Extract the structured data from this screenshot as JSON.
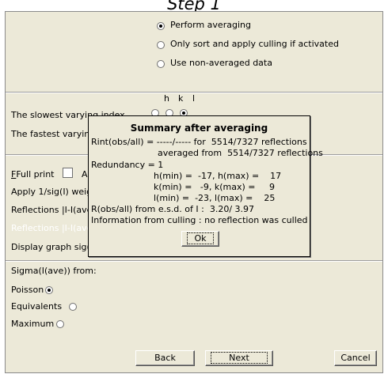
{
  "window": {
    "title": "Step 1"
  },
  "averaging": {
    "options": [
      {
        "label": "Perform averaging",
        "checked": true
      },
      {
        "label": "Only sort and apply culling if activated",
        "checked": false
      },
      {
        "label": "Use non-averaged data",
        "checked": false
      }
    ]
  },
  "index": {
    "headers": [
      "h",
      "k",
      "l"
    ],
    "slowest_label": "The slowest varying index",
    "fastest_label": "The fastest varying index"
  },
  "options": {
    "full_print_label": "Full print",
    "full_print_suffix": "A",
    "apply_label": "Apply 1/sig(I) weig",
    "reflections1_label": "Reflections |I-I(ave",
    "reflections2_label": "Reflections |I-I(ave",
    "display_label": "Display graph sig(I"
  },
  "sigma": {
    "label": "Sigma(I(ave)) from:",
    "options": [
      {
        "label": "Poisson",
        "checked": true
      },
      {
        "label": "Equivalents",
        "checked": false
      },
      {
        "label": "Maximum",
        "checked": false
      }
    ]
  },
  "buttons": {
    "back": "Back",
    "next": "Next",
    "cancel": "Cancel"
  },
  "summary": {
    "title": "Summary after averaging",
    "rint_line": "Rint(obs/all) = -----/----- for  5514/7327 reflections",
    "averaged_line": "averaged from  5514/7327 reflections",
    "redundancy_line": "Redundancy = 1",
    "h_line": "h(min) =  -17, h(max) =    17",
    "k_line": "k(min) =   -9, k(max) =     9",
    "l_line": "l(min) =  -23, l(max) =    25",
    "robs_line": "R(obs/all) from e.s.d. of I :  3.20/ 3.97",
    "culling_line": "Information from culling : no reflection was culled",
    "ok_label": "Ok"
  }
}
